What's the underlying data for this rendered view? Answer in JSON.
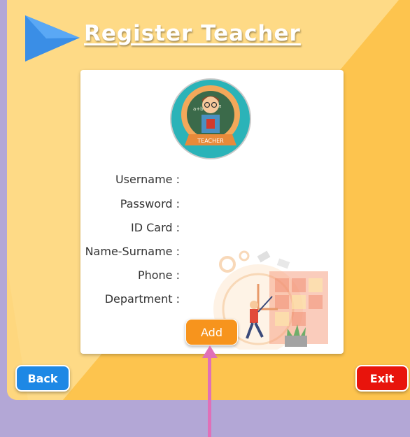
{
  "header": {
    "title": "Register Teacher"
  },
  "avatar": {
    "badge_text": "TEACHER"
  },
  "form": {
    "fields": [
      {
        "label": "Username :"
      },
      {
        "label": "Password :"
      },
      {
        "label": "ID Card :"
      },
      {
        "label": "Name-Surname :"
      },
      {
        "label": "Phone :"
      },
      {
        "label": "Department :"
      }
    ],
    "add_label": "Add"
  },
  "footer": {
    "back_label": "Back",
    "exit_label": "Exit"
  },
  "colors": {
    "background": "#b3a7d6",
    "panel": "#fdc44e",
    "add_button": "#f7941d",
    "back_button": "#1e88e5",
    "exit_button": "#e8140c",
    "pointer": "#e070b8"
  },
  "icons": {
    "header": "play-arrow-icon",
    "pointer": "up-arrow-pointer"
  }
}
